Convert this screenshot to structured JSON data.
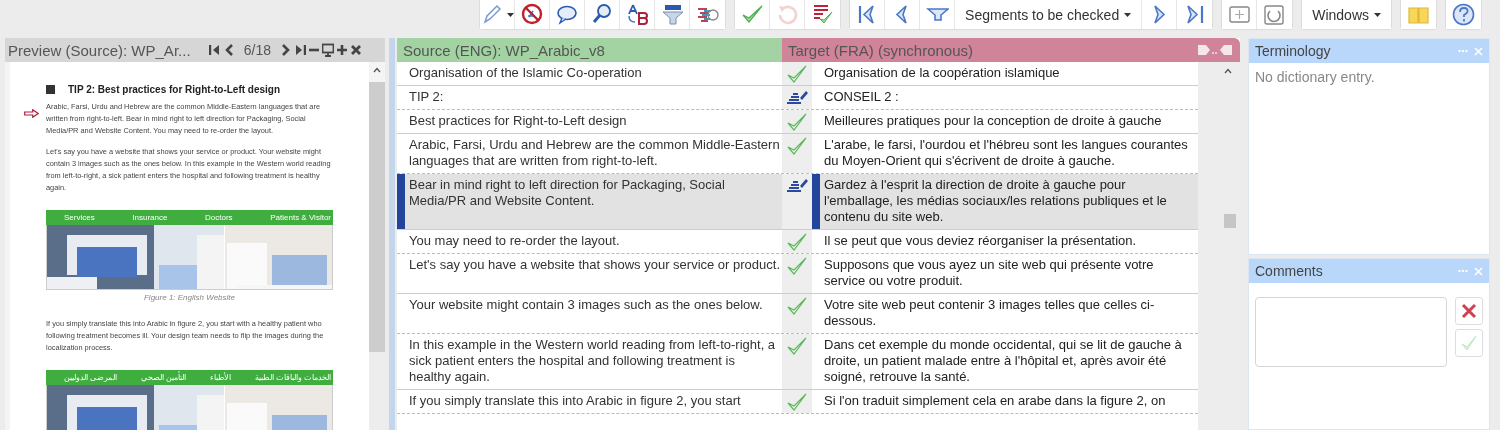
{
  "toolbar": {
    "groups": [
      {
        "items": [
          {
            "kind": "icon-menu",
            "disabled": false
          },
          {
            "kind": "icon",
            "disabled": false
          },
          {
            "kind": "icon",
            "disabled": false
          },
          {
            "kind": "icon",
            "disabled": false
          },
          {
            "kind": "icon",
            "disabled": false
          },
          {
            "kind": "icon",
            "disabled": false
          },
          {
            "kind": "icon",
            "disabled": false
          }
        ]
      },
      {
        "items": [
          {
            "kind": "icon",
            "disabled": false
          },
          {
            "kind": "icon",
            "disabled": true
          },
          {
            "kind": "icon",
            "disabled": false
          }
        ]
      },
      {
        "items": [
          {
            "kind": "icon",
            "disabled": false
          },
          {
            "kind": "icon",
            "disabled": false
          },
          {
            "kind": "icon",
            "disabled": false
          },
          {
            "kind": "menu",
            "label": "Segments to be checked"
          },
          {
            "kind": "icon",
            "disabled": false
          },
          {
            "kind": "icon",
            "disabled": false
          }
        ]
      },
      {
        "items": [
          {
            "kind": "icon",
            "disabled": false
          },
          {
            "kind": "icon",
            "disabled": false
          }
        ]
      },
      {
        "items": [
          {
            "kind": "menu",
            "label": "Windows"
          }
        ]
      },
      {
        "items": [
          {
            "kind": "icon",
            "disabled": false
          }
        ]
      },
      {
        "items": [
          {
            "kind": "icon",
            "disabled": false
          }
        ]
      }
    ]
  },
  "preview": {
    "title": "Preview (Source): WP_Ar...",
    "page": "6/18",
    "blocks": [
      {
        "kind": "heading",
        "text": "TIP 2: Best practices for Right-to-Left design"
      },
      {
        "kind": "paragraph",
        "marked": true,
        "text": "Arabic, Farsi, Urdu and Hebrew are the common Middle-Eastern languages that are written from right-to-left. Bear in mind right to left direction for Packaging, Social Media/PR and Website Content. You may need to re-order the layout."
      },
      {
        "kind": "paragraph",
        "marked": false,
        "text": "Let's say you have a website that shows your service or product. Your website might contain 3 images such as the ones below. In this example in the Western world reading from left-to-right, a sick patient enters the hospital and following treatment is healthy again."
      },
      {
        "kind": "figure",
        "labels": [
          "Services",
          "Insurance",
          "Doctors",
          "Patients & Visitor"
        ],
        "caption": "Figure 1: English Website"
      },
      {
        "kind": "paragraph",
        "marked": false,
        "text": "If you simply translate this into Arabic in figure 2, you start with a healthy patient who following treatment becomes ill. Your design team needs to flip the images during the localization process."
      },
      {
        "kind": "figure",
        "labels": [
          "الخدمات والباقات الطبية",
          "الأطباء",
          "التأمين الصحي",
          "المرضى الدوليين"
        ]
      }
    ]
  },
  "grid": {
    "source_header": "Source (ENG): WP_Arabic_v8",
    "target_header": "Target (FRA) (synchronous)",
    "segments": [
      {
        "source": "Organisation of the Islamic Co-operation",
        "kind": "confirmed",
        "target": "Organisation de la coopération islamique",
        "selected": false
      },
      {
        "source": "TIP 2:",
        "kind": "edited",
        "target": "CONSEIL 2 :",
        "selected": false
      },
      {
        "source": "Best practices for Right-to-Left design",
        "kind": "confirmed",
        "target": "Meilleures pratiques pour la conception de droite à gauche",
        "selected": false
      },
      {
        "source": "Arabic, Farsi, Urdu and Hebrew are the common Middle-Eastern languages that are written from right-to-left.",
        "kind": "confirmed",
        "target": "L'arabe, le farsi, l'ourdou et l'hébreu sont les langues courantes du Moyen-Orient qui s'écrivent de droite à gauche.",
        "selected": false
      },
      {
        "source": "Bear in mind right to left direction for Packaging, Social Media/PR and Website Content.",
        "kind": "edited",
        "target": "Gardez à l'esprit la direction de droite à gauche pour l'emballage, les médias sociaux/les relations publiques et le contenu du site web.",
        "selected": true
      },
      {
        "source": "You may need to re-order the layout.",
        "kind": "confirmed",
        "target": "Il se peut que vous deviez réorganiser la présentation.",
        "selected": false
      },
      {
        "source": "Let's say you have a website that shows your service or product.",
        "kind": "confirmed",
        "target": "Supposons que vous ayez un site web qui présente votre service ou votre produit.",
        "selected": false
      },
      {
        "source": "Your website might contain 3 images such as the ones below.",
        "kind": "confirmed",
        "target": "Votre site web peut contenir 3 images telles que celles ci-dessous.",
        "selected": false
      },
      {
        "source": "In this example in the Western world reading from left-to-right, a sick patient enters the hospital and following treatment is healthy again.",
        "kind": "confirmed",
        "target": "Dans cet exemple du monde occidental, qui se lit de gauche à droite, un patient malade entre à l'hôpital et, après avoir été soigné, retrouve la santé.",
        "selected": false
      },
      {
        "source": "If you simply translate this into Arabic in figure 2, you start",
        "kind": "confirmed",
        "target": "Si l'on traduit simplement cela en arabe dans la figure 2, on",
        "selected": false
      }
    ]
  },
  "terminology": {
    "title": "Terminology",
    "message": "No dictionary entry."
  },
  "comments": {
    "title": "Comments",
    "delete_disabled": false,
    "confirm_disabled": true
  }
}
